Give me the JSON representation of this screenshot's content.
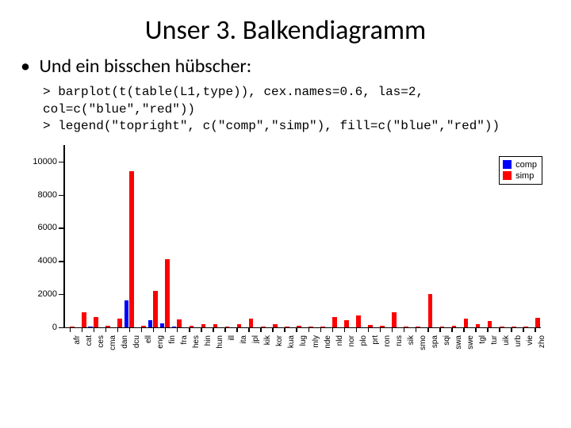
{
  "title": "Unser 3. Balkendiagramm",
  "bullet": "Und ein bisschen hübscher:",
  "code": "> barplot(t(table(L1,type)), cex.names=0.6, las=2,\ncol=c(\"blue\",\"red\"))\n> legend(\"topright\", c(\"comp\",\"simp\"), fill=c(\"blue\",\"red\"))",
  "chart_data": {
    "type": "bar",
    "stacked": true,
    "title": "",
    "xlabel": "",
    "ylabel": "",
    "ylim": [
      0,
      11000
    ],
    "y_ticks": [
      0,
      2000,
      4000,
      6000,
      8000,
      10000
    ],
    "categories": [
      "afr",
      "cat",
      "ces",
      "cma",
      "dan",
      "dcu",
      "ell",
      "eng",
      "fin",
      "fra",
      "hes",
      "hin",
      "hun",
      "ill",
      "ita",
      "jpl",
      "kik",
      "kor",
      "kua",
      "lug",
      "mly",
      "nde",
      "nld",
      "nor",
      "plo",
      "prt",
      "ron",
      "rus",
      "sik",
      "smo",
      "spa",
      "sqi",
      "swa",
      "swe",
      "tgl",
      "tur",
      "uik",
      "urb",
      "vie",
      "zho"
    ],
    "series": [
      {
        "name": "comp",
        "color": "#0000ff",
        "values": [
          0,
          0,
          20,
          0,
          0,
          1600,
          0,
          400,
          250,
          20,
          0,
          0,
          0,
          0,
          0,
          0,
          0,
          0,
          0,
          0,
          0,
          0,
          0,
          0,
          0,
          0,
          0,
          0,
          0,
          0,
          0,
          0,
          0,
          0,
          0,
          0,
          0,
          0,
          0,
          0
        ]
      },
      {
        "name": "simp",
        "color": "#ff0000",
        "values": [
          50,
          900,
          600,
          80,
          500,
          9400,
          100,
          2200,
          4100,
          450,
          80,
          200,
          200,
          40,
          200,
          500,
          60,
          200,
          60,
          80,
          60,
          40,
          600,
          400,
          700,
          120,
          80,
          900,
          40,
          40,
          2000,
          40,
          100,
          500,
          200,
          350,
          50,
          60,
          60,
          550
        ]
      }
    ],
    "legend": {
      "position": "topright",
      "items": [
        {
          "label": "comp",
          "color": "#0000ff"
        },
        {
          "label": "simp",
          "color": "#ff0000"
        }
      ]
    }
  }
}
